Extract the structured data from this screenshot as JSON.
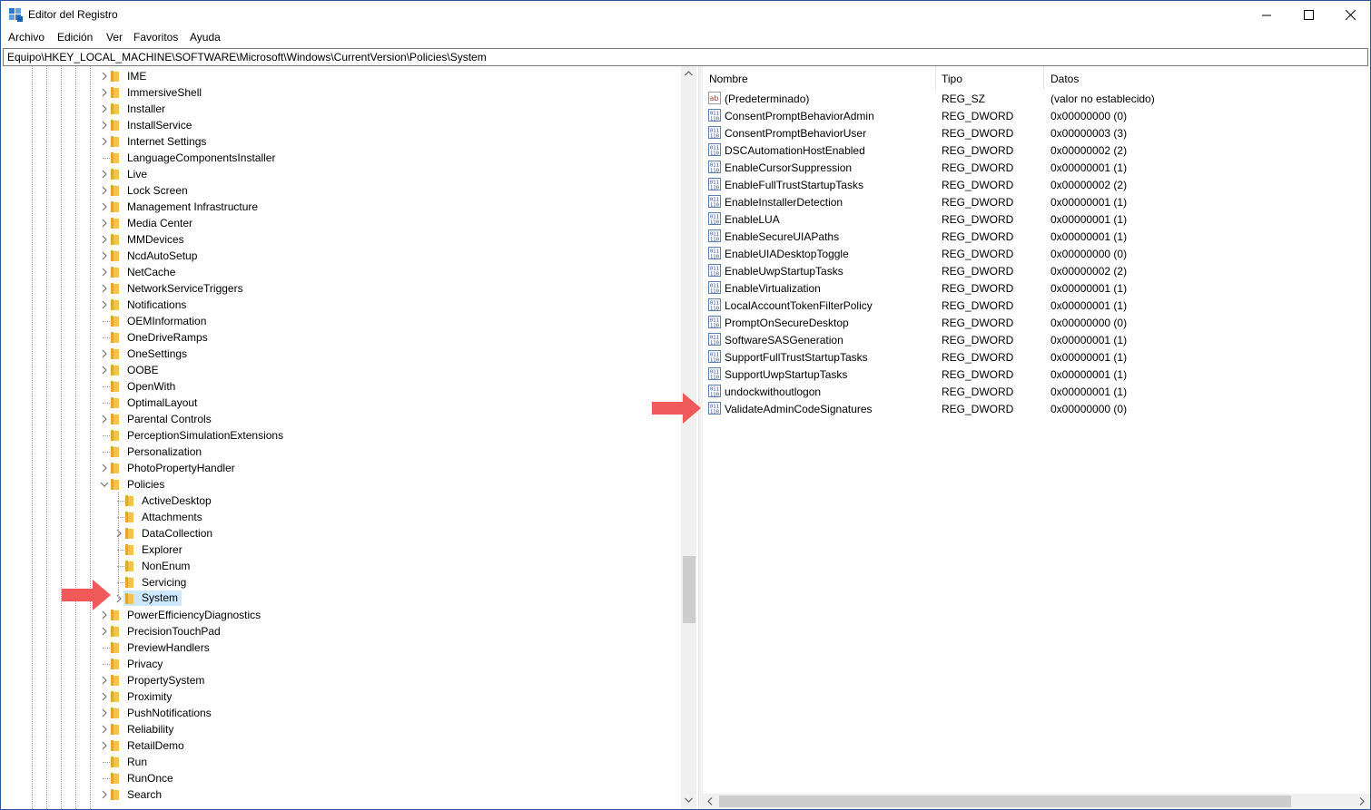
{
  "window": {
    "title": "Editor del Registro"
  },
  "menu": [
    "Archivo",
    "Edición",
    "Ver",
    "Favoritos",
    "Ayuda"
  ],
  "address": "Equipo\\HKEY_LOCAL_MACHINE\\SOFTWARE\\Microsoft\\Windows\\CurrentVersion\\Policies\\System",
  "tree": {
    "items": [
      {
        "label": "IME",
        "expandable": true,
        "level": 0
      },
      {
        "label": "ImmersiveShell",
        "expandable": true,
        "level": 0
      },
      {
        "label": "Installer",
        "expandable": true,
        "level": 0
      },
      {
        "label": "InstallService",
        "expandable": true,
        "level": 0
      },
      {
        "label": "Internet Settings",
        "expandable": true,
        "level": 0
      },
      {
        "label": "LanguageComponentsInstaller",
        "expandable": false,
        "level": 0
      },
      {
        "label": "Live",
        "expandable": true,
        "level": 0
      },
      {
        "label": "Lock Screen",
        "expandable": true,
        "level": 0
      },
      {
        "label": "Management Infrastructure",
        "expandable": true,
        "level": 0
      },
      {
        "label": "Media Center",
        "expandable": true,
        "level": 0
      },
      {
        "label": "MMDevices",
        "expandable": true,
        "level": 0
      },
      {
        "label": "NcdAutoSetup",
        "expandable": true,
        "level": 0
      },
      {
        "label": "NetCache",
        "expandable": true,
        "level": 0
      },
      {
        "label": "NetworkServiceTriggers",
        "expandable": true,
        "level": 0
      },
      {
        "label": "Notifications",
        "expandable": true,
        "level": 0
      },
      {
        "label": "OEMInformation",
        "expandable": false,
        "level": 0
      },
      {
        "label": "OneDriveRamps",
        "expandable": false,
        "level": 0
      },
      {
        "label": "OneSettings",
        "expandable": true,
        "level": 0
      },
      {
        "label": "OOBE",
        "expandable": true,
        "level": 0
      },
      {
        "label": "OpenWith",
        "expandable": false,
        "level": 0
      },
      {
        "label": "OptimalLayout",
        "expandable": false,
        "level": 0
      },
      {
        "label": "Parental Controls",
        "expandable": true,
        "level": 0
      },
      {
        "label": "PerceptionSimulationExtensions",
        "expandable": false,
        "level": 0
      },
      {
        "label": "Personalization",
        "expandable": false,
        "level": 0
      },
      {
        "label": "PhotoPropertyHandler",
        "expandable": true,
        "level": 0
      },
      {
        "label": "Policies",
        "expandable": true,
        "expanded": true,
        "level": 0
      },
      {
        "label": "ActiveDesktop",
        "expandable": false,
        "level": 1
      },
      {
        "label": "Attachments",
        "expandable": false,
        "level": 1
      },
      {
        "label": "DataCollection",
        "expandable": true,
        "level": 1
      },
      {
        "label": "Explorer",
        "expandable": false,
        "level": 1
      },
      {
        "label": "NonEnum",
        "expandable": false,
        "level": 1
      },
      {
        "label": "Servicing",
        "expandable": false,
        "level": 1
      },
      {
        "label": "System",
        "expandable": true,
        "level": 1,
        "selected": true
      },
      {
        "label": "PowerEfficiencyDiagnostics",
        "expandable": true,
        "level": 0
      },
      {
        "label": "PrecisionTouchPad",
        "expandable": true,
        "level": 0
      },
      {
        "label": "PreviewHandlers",
        "expandable": false,
        "level": 0
      },
      {
        "label": "Privacy",
        "expandable": false,
        "level": 0
      },
      {
        "label": "PropertySystem",
        "expandable": true,
        "level": 0
      },
      {
        "label": "Proximity",
        "expandable": true,
        "level": 0
      },
      {
        "label": "PushNotifications",
        "expandable": true,
        "level": 0
      },
      {
        "label": "Reliability",
        "expandable": true,
        "level": 0
      },
      {
        "label": "RetailDemo",
        "expandable": true,
        "level": 0
      },
      {
        "label": "Run",
        "expandable": false,
        "level": 0
      },
      {
        "label": "RunOnce",
        "expandable": false,
        "level": 0
      },
      {
        "label": "Search",
        "expandable": true,
        "level": 0
      }
    ]
  },
  "columns": {
    "name": "Nombre",
    "type": "Tipo",
    "data": "Datos"
  },
  "values": [
    {
      "icon": "string-value-icon",
      "name": "(Predeterminado)",
      "type": "REG_SZ",
      "data": "(valor no establecido)"
    },
    {
      "icon": "binary-value-icon",
      "name": "ConsentPromptBehaviorAdmin",
      "type": "REG_DWORD",
      "data": "0x00000000 (0)"
    },
    {
      "icon": "binary-value-icon",
      "name": "ConsentPromptBehaviorUser",
      "type": "REG_DWORD",
      "data": "0x00000003 (3)"
    },
    {
      "icon": "binary-value-icon",
      "name": "DSCAutomationHostEnabled",
      "type": "REG_DWORD",
      "data": "0x00000002 (2)"
    },
    {
      "icon": "binary-value-icon",
      "name": "EnableCursorSuppression",
      "type": "REG_DWORD",
      "data": "0x00000001 (1)"
    },
    {
      "icon": "binary-value-icon",
      "name": "EnableFullTrustStartupTasks",
      "type": "REG_DWORD",
      "data": "0x00000002 (2)"
    },
    {
      "icon": "binary-value-icon",
      "name": "EnableInstallerDetection",
      "type": "REG_DWORD",
      "data": "0x00000001 (1)"
    },
    {
      "icon": "binary-value-icon",
      "name": "EnableLUA",
      "type": "REG_DWORD",
      "data": "0x00000001 (1)"
    },
    {
      "icon": "binary-value-icon",
      "name": "EnableSecureUIAPaths",
      "type": "REG_DWORD",
      "data": "0x00000001 (1)"
    },
    {
      "icon": "binary-value-icon",
      "name": "EnableUIADesktopToggle",
      "type": "REG_DWORD",
      "data": "0x00000000 (0)"
    },
    {
      "icon": "binary-value-icon",
      "name": "EnableUwpStartupTasks",
      "type": "REG_DWORD",
      "data": "0x00000002 (2)"
    },
    {
      "icon": "binary-value-icon",
      "name": "EnableVirtualization",
      "type": "REG_DWORD",
      "data": "0x00000001 (1)"
    },
    {
      "icon": "binary-value-icon",
      "name": "LocalAccountTokenFilterPolicy",
      "type": "REG_DWORD",
      "data": "0x00000001 (1)"
    },
    {
      "icon": "binary-value-icon",
      "name": "PromptOnSecureDesktop",
      "type": "REG_DWORD",
      "data": "0x00000000 (0)"
    },
    {
      "icon": "binary-value-icon",
      "name": "SoftwareSASGeneration",
      "type": "REG_DWORD",
      "data": "0x00000001 (1)"
    },
    {
      "icon": "binary-value-icon",
      "name": "SupportFullTrustStartupTasks",
      "type": "REG_DWORD",
      "data": "0x00000001 (1)"
    },
    {
      "icon": "binary-value-icon",
      "name": "SupportUwpStartupTasks",
      "type": "REG_DWORD",
      "data": "0x00000001 (1)"
    },
    {
      "icon": "binary-value-icon",
      "name": "undockwithoutlogon",
      "type": "REG_DWORD",
      "data": "0x00000001 (1)"
    },
    {
      "icon": "binary-value-icon",
      "name": "ValidateAdminCodeSignatures",
      "type": "REG_DWORD",
      "data": "0x00000000 (0)"
    }
  ],
  "colors": {
    "folder": "#f5c24c",
    "selection": "#cce8ff",
    "annotation_arrow": "#f05a5a",
    "accent": "#2b579a"
  }
}
